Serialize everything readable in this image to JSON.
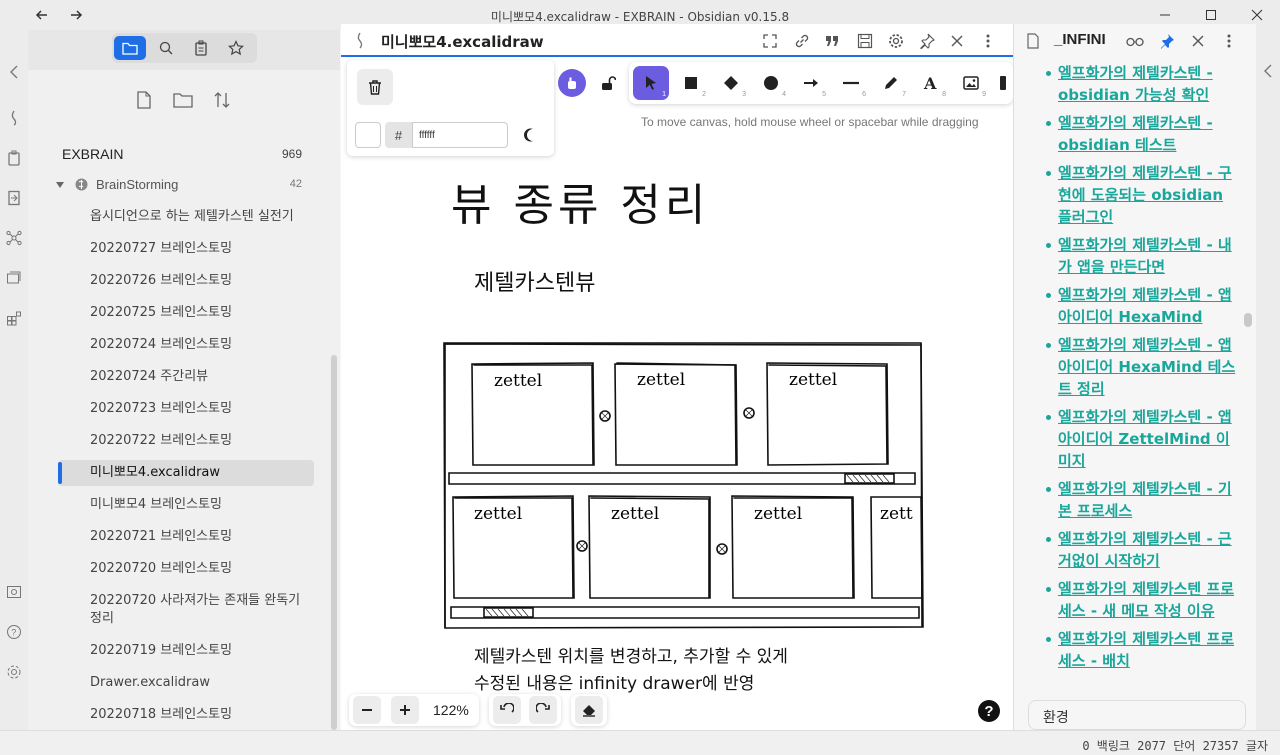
{
  "window": {
    "title": "미니뽀모4.excalidraw - EXBRAIN - Obsidian v0.15.8"
  },
  "left_sidebar": {
    "vault_name": "EXBRAIN",
    "vault_count": "969",
    "folder": {
      "name": "BrainStorming",
      "count": "42"
    },
    "files": [
      "옵시디언으로 하는 제텔카스텐 실전기",
      "20220727 브레인스토밍",
      "20220726 브레인스토밍",
      "20220725 브레인스토밍",
      "20220724 브레인스토밍",
      "20220724 주간리뷰",
      "20220723 브레인스토밍",
      "20220722 브레인스토밍",
      "미니뽀모4.excalidraw",
      "미니뽀모4 브레인스토밍",
      "20220721 브레인스토밍",
      "20220720 브레인스토밍",
      "20220720 사라져가는 존재들 완독기 정리",
      "20220719 브레인스토밍",
      "Drawer.excalidraw",
      "20220718 브레인스토밍"
    ],
    "active_index": 8
  },
  "main": {
    "tab_title": "미니뽀모4.excalidraw",
    "color_hex": "ffffff",
    "hint": "To move canvas, hold mouse wheel or spacebar while dragging",
    "tool_numbers": [
      "1",
      "2",
      "3",
      "4",
      "5",
      "6",
      "7",
      "8",
      "9"
    ],
    "drawing": {
      "title": "뷰 종류 정리",
      "subtitle": "제텔카스텐뷰",
      "card_label": "zettel",
      "card_label_cut": "zett",
      "note_line1": "제텔카스텐 위치를 변경하고, 추가할 수 있게",
      "note_line2": "수정된 내용은 infinity drawer에 반영"
    },
    "zoom": "122%"
  },
  "right_sidebar": {
    "title": "_INFINI",
    "links": [
      "엘프화가의 제텔카스텐 - obsidian 가능성 확인",
      "엘프화가의 제텔카스텐 - obsidian 테스트",
      "엘프화가의 제텔카스텐 - 구현에 도움되는 obsidian 플러그인",
      "엘프화가의 제텔카스텐 - 내가 앱을 만든다면",
      "엘프화가의 제텔카스텐 - 앱 아이디어 HexaMind",
      "엘프화가의 제텔카스텐 - 앱 아이디어 HexaMind 테스트 정리",
      "엘프화가의 제텔카스텐 - 앱 아이디어 ZettelMind 이미지",
      "엘프화가의 제텔카스텐 - 기본 프로세스",
      "엘프화가의 제텔카스텐 - 근거없이 시작하기",
      "엘프화가의 제텔카스텐 프로세스 - 새 메모 작성 이유",
      "엘프화가의 제텔카스텐 프로세스 - 배치"
    ],
    "search_value": "환경"
  },
  "status_bar": {
    "text": "0 백링크  2077 단어  27357 글자"
  },
  "colors": {
    "accent": "#1e6fe6",
    "tool_active": "#6b5ce0",
    "link": "#1aa69b"
  }
}
